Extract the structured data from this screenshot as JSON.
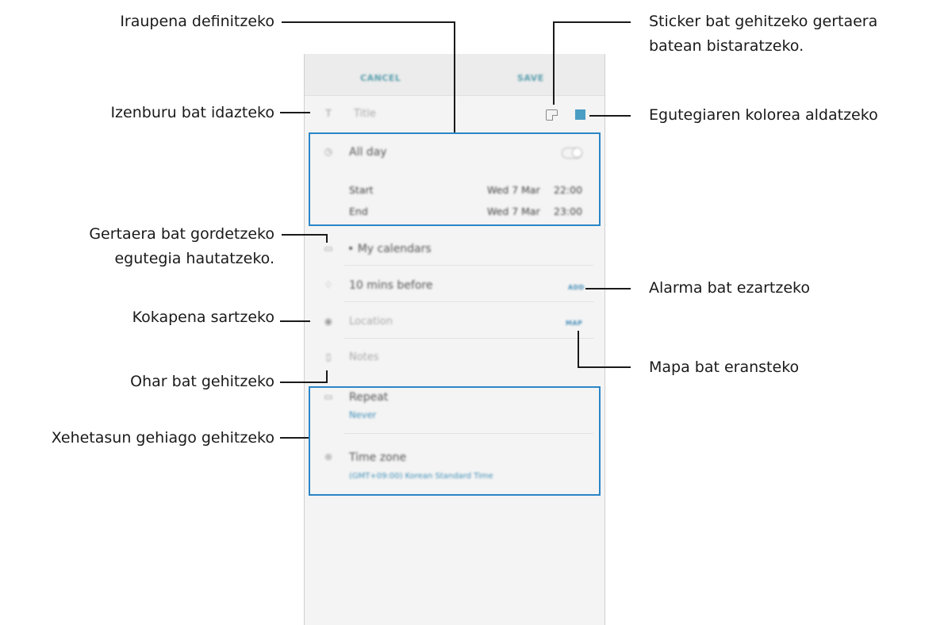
{
  "phone": {
    "topbar": {
      "cancel_label": "CANCEL",
      "save_label": "SAVE"
    },
    "title_placeholder": "Title",
    "title_icon": "text-format-icon",
    "duration": {
      "all_day_label": "All day",
      "all_day_on": false,
      "start_label": "Start",
      "start_date": "Wed 7 Mar",
      "start_time": "22:00",
      "end_label": "End",
      "end_date": "Wed 7 Mar",
      "end_time": "23:00"
    },
    "calendar_value": "• My calendars",
    "alarm_value": "10 mins before",
    "alarm_action": "ADD",
    "location_placeholder": "Location",
    "location_action": "MAP",
    "notes_placeholder": "Notes",
    "repeat_label": "Repeat",
    "repeat_value": "Never",
    "timezone_label": "Time zone",
    "timezone_value": "(GMT+09:00) Korean Standard Time",
    "colors": {
      "accent": "#4a9ec4",
      "highlight": "#2a86c6"
    }
  },
  "callouts": {
    "duration": "Iraupena definitzeko",
    "title": "Izenburu bat idazteko",
    "calendar_line1": "Gertaera bat gordetzeko",
    "calendar_line2": "egutegia hautatzeko.",
    "location": "Kokapena sartzeko",
    "notes": "Ohar bat gehitzeko",
    "details": "Xehetasun gehiago gehitzeko",
    "sticker_line1": "Sticker bat gehitzeko gertaera",
    "sticker_line2": "batean bistaratzeko.",
    "color": "Egutegiaren kolorea aldatzeko",
    "alarm": "Alarma bat ezartzeko",
    "map": "Mapa bat eransteko"
  }
}
